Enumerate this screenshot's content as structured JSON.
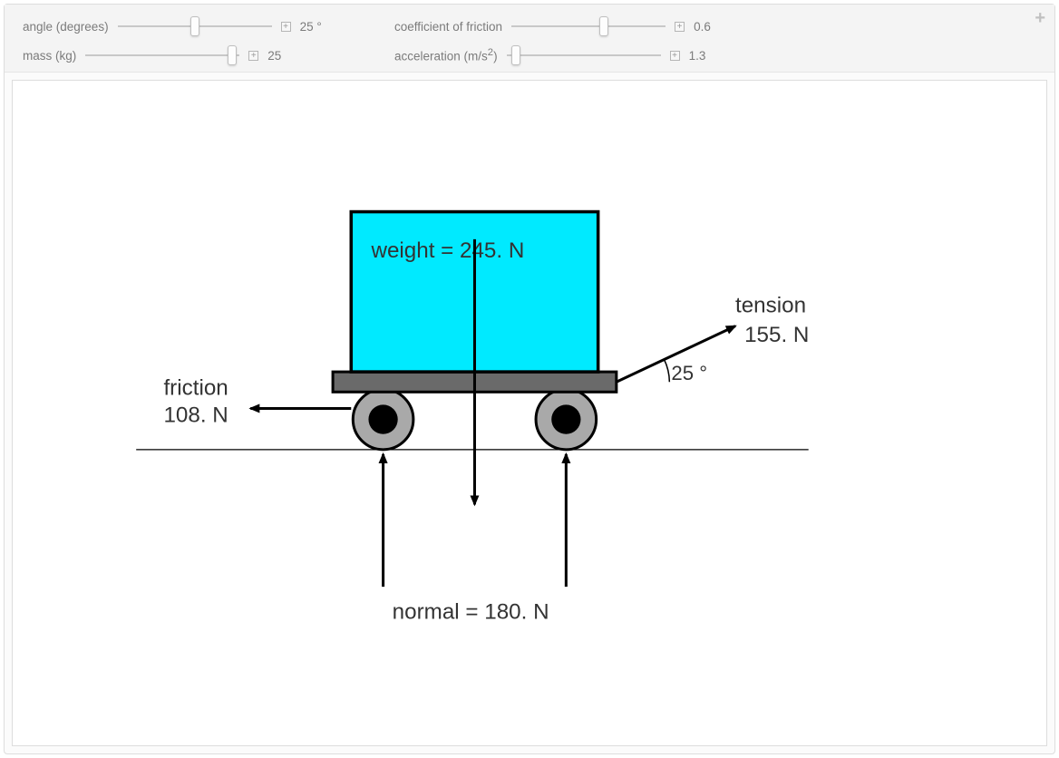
{
  "controls": {
    "angle": {
      "label": "angle (degrees)",
      "value": "25 °",
      "slider_width": 170,
      "thumb_pct": 50
    },
    "mass": {
      "label": "mass (kg)",
      "value": "25",
      "slider_width": 170,
      "thumb_pct": 95
    },
    "friction": {
      "label": "coefficient of friction",
      "value": "0.6",
      "slider_width": 170,
      "thumb_pct": 60
    },
    "accel": {
      "label": "acceleration (m/s",
      "sup": "2",
      "label_after": ")",
      "value": "1.3",
      "slider_width": 170,
      "thumb_pct": 6
    }
  },
  "corner_icon": "+",
  "diagram": {
    "weight_label": "weight = 245. N",
    "normal_label": "normal = 180. N",
    "friction_label1": "friction",
    "friction_label2": "108. N",
    "tension_label1": "tension",
    "tension_label2": "155. N",
    "angle_label": "25 °",
    "colors": {
      "box_fill": "#00eaff",
      "box_stroke": "#000000",
      "platform": "#6a6a6a",
      "wheel_rim": "#a9a9a9",
      "wheel_hub": "#000000",
      "arrow": "#000000",
      "ground": "#000000"
    }
  },
  "chart_data": {
    "type": "diagram",
    "forces": {
      "weight_N": 245,
      "normal_N": 180,
      "friction_N": 108,
      "tension_N": 155
    },
    "parameters": {
      "angle_deg": 25,
      "mass_kg": 25,
      "coefficient_of_friction": 0.6,
      "acceleration_m_s2": 1.3
    }
  }
}
